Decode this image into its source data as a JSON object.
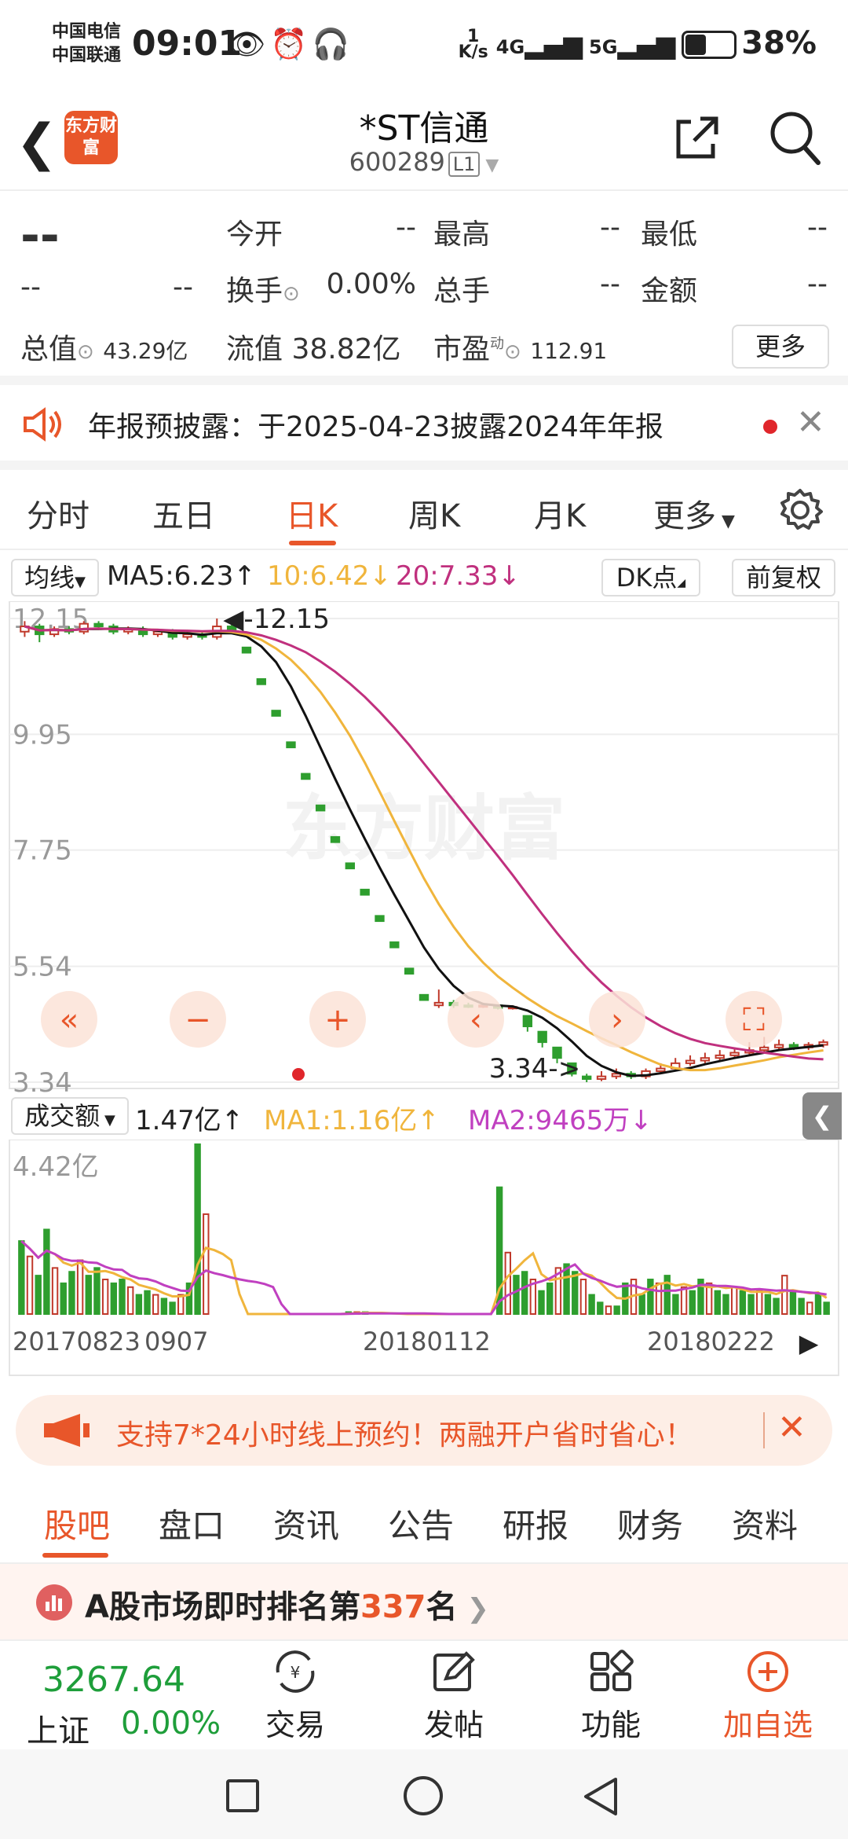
{
  "status": {
    "carrier1": "中国电信",
    "carrier2": "中国联通",
    "time": "09:01",
    "net_speed_top": "1",
    "net_speed_unit": "K/s",
    "signal1": "4G",
    "signal2": "5G",
    "battery": "38%"
  },
  "header": {
    "logo": "东方财富",
    "title": "*ST信通",
    "code": "600289",
    "level": "L1"
  },
  "quote": {
    "price": "--",
    "change": "--",
    "change_pct": "--",
    "open_label": "今开",
    "open": "--",
    "high_label": "最高",
    "high": "--",
    "low_label": "最低",
    "low": "--",
    "turnover_label": "换手",
    "turnover": "0.00%",
    "vol_label": "总手",
    "vol": "--",
    "amount_label": "金额",
    "amount": "--",
    "mktcap_label": "总值",
    "mktcap": "43.29亿",
    "float_label": "流值",
    "float": "38.82亿",
    "pe_label": "市盈",
    "pe_sup": "动",
    "pe": "112.91",
    "more": "更多"
  },
  "notice": {
    "text": "年报预披露：于2025-04-23披露2024年年报"
  },
  "tabs": [
    "分时",
    "五日",
    "日K",
    "周K",
    "月K",
    "更多"
  ],
  "ma": {
    "selector": "均线",
    "ma5": "MA5:6.23↑",
    "ma10": "10:6.42↓",
    "ma20": "20:7.33↓",
    "dk": "DK点",
    "adjust": "前复权"
  },
  "chart_data": [
    {
      "type": "candlestick",
      "title": "日K",
      "y_ticks": [
        "12.15",
        "9.95",
        "7.75",
        "5.54",
        "3.34"
      ],
      "ylim": [
        3.34,
        12.15
      ],
      "max_label": "-12.15",
      "min_label": "3.34->",
      "series": [
        {
          "name": "MA5",
          "color": "#111111"
        },
        {
          "name": "MA10",
          "color": "#f0b53c"
        },
        {
          "name": "MA20",
          "color": "#c0307e"
        }
      ],
      "candles": [
        {
          "o": 11.9,
          "c": 12.0,
          "h": 12.1,
          "l": 11.8
        },
        {
          "o": 12.0,
          "c": 11.85,
          "h": 12.05,
          "l": 11.7
        },
        {
          "o": 11.85,
          "c": 11.95,
          "h": 12.0,
          "l": 11.8
        },
        {
          "o": 11.95,
          "c": 11.9,
          "h": 12.0,
          "l": 11.85
        },
        {
          "o": 11.9,
          "c": 12.05,
          "h": 12.1,
          "l": 11.85
        },
        {
          "o": 12.05,
          "c": 12.0,
          "h": 12.1,
          "l": 11.95
        },
        {
          "o": 12.0,
          "c": 11.9,
          "h": 12.05,
          "l": 11.85
        },
        {
          "o": 11.9,
          "c": 11.95,
          "h": 12.0,
          "l": 11.85
        },
        {
          "o": 11.95,
          "c": 11.85,
          "h": 12.0,
          "l": 11.8
        },
        {
          "o": 11.85,
          "c": 11.9,
          "h": 11.95,
          "l": 11.8
        },
        {
          "o": 11.9,
          "c": 11.8,
          "h": 11.95,
          "l": 11.75
        },
        {
          "o": 11.8,
          "c": 11.85,
          "h": 11.9,
          "l": 11.75
        },
        {
          "o": 11.85,
          "c": 11.8,
          "h": 11.9,
          "l": 11.75
        },
        {
          "o": 11.8,
          "c": 12.0,
          "h": 12.15,
          "l": 11.75
        },
        {
          "o": 12.0,
          "c": 11.9,
          "h": 12.15,
          "l": 11.85
        },
        {
          "o": 11.6,
          "c": 11.5,
          "h": 11.6,
          "l": 11.5
        },
        {
          "o": 11.0,
          "c": 10.9,
          "h": 11.0,
          "l": 10.9
        },
        {
          "o": 10.4,
          "c": 10.3,
          "h": 10.4,
          "l": 10.3
        },
        {
          "o": 9.8,
          "c": 9.7,
          "h": 9.8,
          "l": 9.7
        },
        {
          "o": 9.2,
          "c": 9.1,
          "h": 9.2,
          "l": 9.1
        },
        {
          "o": 8.6,
          "c": 8.5,
          "h": 8.6,
          "l": 8.5
        },
        {
          "o": 8.0,
          "c": 7.9,
          "h": 8.0,
          "l": 7.9
        },
        {
          "o": 7.5,
          "c": 7.4,
          "h": 7.5,
          "l": 7.4
        },
        {
          "o": 7.0,
          "c": 6.9,
          "h": 7.0,
          "l": 6.9
        },
        {
          "o": 6.5,
          "c": 6.4,
          "h": 6.5,
          "l": 6.4
        },
        {
          "o": 6.0,
          "c": 5.9,
          "h": 6.0,
          "l": 5.9
        },
        {
          "o": 5.5,
          "c": 5.4,
          "h": 5.5,
          "l": 5.4
        },
        {
          "o": 5.0,
          "c": 4.9,
          "h": 5.0,
          "l": 4.9
        },
        {
          "o": 4.8,
          "c": 4.85,
          "h": 5.1,
          "l": 4.75
        },
        {
          "o": 4.85,
          "c": 4.8,
          "h": 4.9,
          "l": 4.75
        },
        {
          "o": 4.8,
          "c": 4.78,
          "h": 4.85,
          "l": 4.75
        },
        {
          "o": 4.78,
          "c": 4.8,
          "h": 4.85,
          "l": 4.75
        },
        {
          "o": 4.8,
          "c": 4.75,
          "h": 4.82,
          "l": 4.72
        },
        {
          "o": 4.75,
          "c": 4.77,
          "h": 4.8,
          "l": 4.72
        },
        {
          "o": 4.6,
          "c": 4.4,
          "h": 4.6,
          "l": 4.3
        },
        {
          "o": 4.3,
          "c": 4.1,
          "h": 4.3,
          "l": 4.0
        },
        {
          "o": 4.0,
          "c": 3.8,
          "h": 4.0,
          "l": 3.7
        },
        {
          "o": 3.7,
          "c": 3.5,
          "h": 3.7,
          "l": 3.45
        },
        {
          "o": 3.45,
          "c": 3.4,
          "h": 3.5,
          "l": 3.34
        },
        {
          "o": 3.4,
          "c": 3.45,
          "h": 3.55,
          "l": 3.36
        },
        {
          "o": 3.45,
          "c": 3.5,
          "h": 3.6,
          "l": 3.4
        },
        {
          "o": 3.5,
          "c": 3.45,
          "h": 3.55,
          "l": 3.4
        },
        {
          "o": 3.45,
          "c": 3.55,
          "h": 3.6,
          "l": 3.4
        },
        {
          "o": 3.55,
          "c": 3.6,
          "h": 3.7,
          "l": 3.5
        },
        {
          "o": 3.6,
          "c": 3.7,
          "h": 3.8,
          "l": 3.55
        },
        {
          "o": 3.7,
          "c": 3.75,
          "h": 3.85,
          "l": 3.65
        },
        {
          "o": 3.75,
          "c": 3.8,
          "h": 3.9,
          "l": 3.7
        },
        {
          "o": 3.8,
          "c": 3.85,
          "h": 3.95,
          "l": 3.75
        },
        {
          "o": 3.85,
          "c": 3.9,
          "h": 4.0,
          "l": 3.8
        },
        {
          "o": 3.9,
          "c": 3.95,
          "h": 4.1,
          "l": 3.85
        },
        {
          "o": 3.95,
          "c": 4.0,
          "h": 4.2,
          "l": 3.9
        },
        {
          "o": 4.0,
          "c": 4.05,
          "h": 4.15,
          "l": 3.95
        },
        {
          "o": 4.05,
          "c": 4.0,
          "h": 4.1,
          "l": 3.95
        },
        {
          "o": 4.0,
          "c": 4.05,
          "h": 4.1,
          "l": 3.95
        },
        {
          "o": 4.05,
          "c": 4.1,
          "h": 4.15,
          "l": 4.0
        }
      ]
    },
    {
      "type": "bar",
      "title": "成交额",
      "y_ticks": [
        "4.42亿"
      ],
      "x_ticks": [
        "20170823",
        "0907",
        "20180112",
        "20180222"
      ],
      "series": [
        {
          "name": "MA1",
          "color": "#f0b53c"
        },
        {
          "name": "MA2",
          "color": "#c040c0"
        }
      ],
      "values_yi": [
        1.9,
        1.5,
        1.0,
        2.2,
        1.2,
        0.8,
        1.1,
        1.4,
        1.0,
        1.2,
        0.9,
        0.8,
        0.9,
        0.7,
        0.5,
        0.6,
        0.5,
        0.4,
        0.3,
        0.5,
        0.8,
        4.42,
        2.6,
        0,
        0,
        0,
        0,
        0,
        0,
        0,
        0,
        0,
        0,
        0,
        0,
        0,
        0,
        0,
        0,
        0.05,
        0.05,
        0.05,
        0,
        0,
        0,
        0,
        0,
        0,
        0,
        0,
        0,
        0,
        0,
        0,
        0,
        0,
        0,
        3.3,
        1.6,
        1.0,
        1.1,
        0.9,
        0.6,
        0.8,
        1.2,
        1.3,
        1.1,
        0.9,
        0.5,
        0.3,
        0.2,
        0.2,
        0.8,
        0.9,
        0.5,
        0.9,
        0.8,
        1.0,
        0.5,
        0.7,
        0.6,
        0.9,
        0.8,
        0.6,
        0.5,
        0.7,
        0.6,
        0.5,
        0.6,
        0.5,
        0.4,
        1.0,
        0.6,
        0.4,
        0.3,
        0.5,
        0.3
      ],
      "vol_labels": {
        "value": "1.47亿↑",
        "ma1": "MA1:1.16亿↑",
        "ma2": "MA2:9465万↓"
      }
    }
  ],
  "chart_labels": {
    "watermark": "东方财富"
  },
  "vol": {
    "selector": "成交额"
  },
  "banner": {
    "text": "支持7*24小时线上预约！两融开户省时省心！"
  },
  "bottom_tabs": [
    "股吧",
    "盘口",
    "资讯",
    "公告",
    "研报",
    "财务",
    "资料"
  ],
  "rank": {
    "prefix": "A股市场即时排名第",
    "num": "337",
    "suffix": "名"
  },
  "actions": {
    "index_value": "3267.64",
    "index_name": "上证",
    "index_change": "0.00%",
    "trade": "交易",
    "post": "发帖",
    "func": "功能",
    "add": "加自选"
  },
  "colors": {
    "accent": "#e8562a",
    "up": "#c0392b",
    "down": "#2e9e2e",
    "ma5": "#111111",
    "ma10": "#f0b53c",
    "ma20": "#c0307e"
  }
}
